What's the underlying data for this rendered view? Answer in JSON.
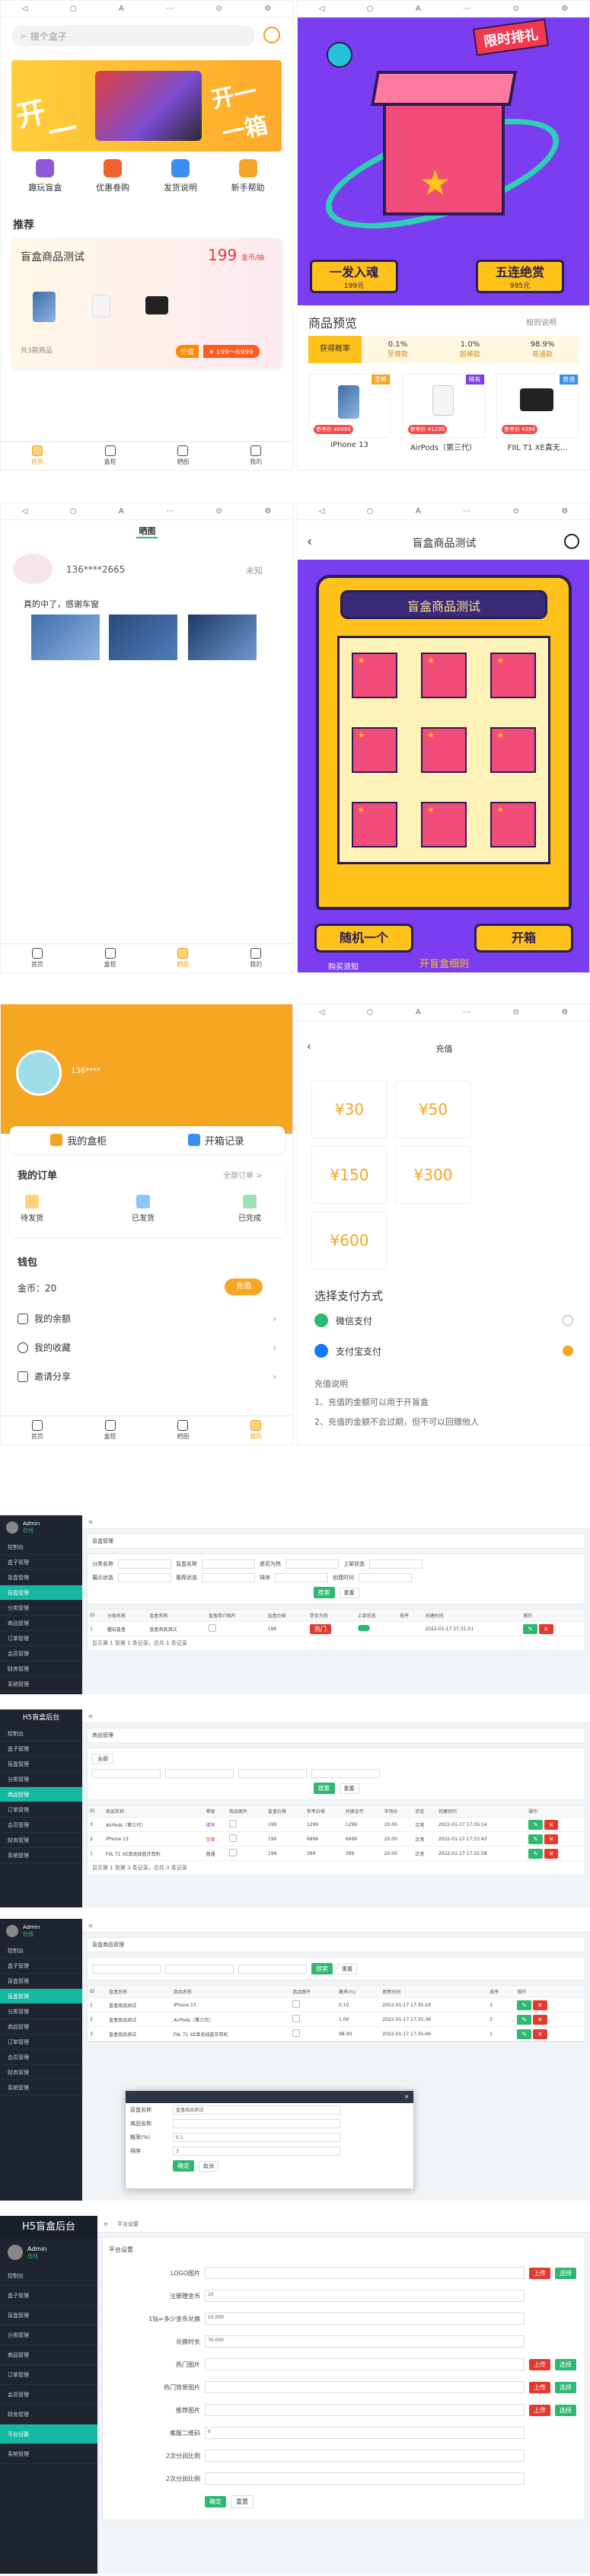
{
  "home": {
    "search_placeholder": "搜个盒子",
    "banner_words": [
      "开",
      "一",
      "开一",
      "一箱"
    ],
    "menu": [
      "趣玩盲盒",
      "优惠卷购",
      "发货说明",
      "新手帮助"
    ],
    "section_title": "推荐",
    "card_title": "盲盒商品测试",
    "card_price": "199",
    "card_price_unit": "金币/抽",
    "card_count": "共3款商品",
    "card_tag": "价值",
    "card_range": "¥ 199～6999",
    "tabs": [
      "首页",
      "盒柜",
      "晒图",
      "我的"
    ]
  },
  "box_detail": {
    "badge": "限时排礼",
    "btn1_label": "一发入魂",
    "btn1_price": "199元",
    "btn2_label": "五连绝赏",
    "btn2_price": "995元",
    "preview_title": "商品预览",
    "rule_link": "规则说明",
    "prob_header": "获得概率",
    "probs": [
      {
        "value": "0.1%",
        "label": "至尊款"
      },
      {
        "value": "1.0%",
        "label": "超稀款"
      },
      {
        "value": "98.9%",
        "label": "普通款"
      }
    ],
    "items": [
      {
        "tag": "至尊",
        "price": "参考价 ¥6999",
        "name": "iPhone 13"
      },
      {
        "tag": "稀有",
        "price": "参考价 ¥1299",
        "name": "AirPods（第三代）"
      },
      {
        "tag": "普通",
        "price": "参考价 ¥399",
        "name": "FIIL T1 XE真无..."
      }
    ]
  },
  "show": {
    "title": "晒图",
    "user": "136****2665",
    "status": "未知",
    "text": "真的中了，感谢车窗",
    "tabs": [
      "首页",
      "盒柜",
      "晒图",
      "我的"
    ]
  },
  "machine": {
    "title": "盲盒商品测试",
    "screen": "盲盒商品测试",
    "btn_random": "随机一个",
    "btn_open": "开箱",
    "rule": "开盲盒细则",
    "notice": "购买须知"
  },
  "mine": {
    "user": "136****",
    "card1": "我的盒柜",
    "card2": "开箱记录",
    "orders_title": "我的订单",
    "orders_all": "全部订单 >",
    "order_states": [
      "待发货",
      "已发货",
      "已完成"
    ],
    "wallet_title": "钱包",
    "coins_label": "金币：20",
    "recharge": "充值",
    "links": [
      "我的余额",
      "我的收藏",
      "邀请分享"
    ],
    "tabs": [
      "首页",
      "盒柜",
      "晒图",
      "我的"
    ]
  },
  "recharge": {
    "title": "充值",
    "amounts": [
      "¥30",
      "¥50",
      "¥150",
      "¥300",
      "¥600"
    ],
    "pay_title": "选择支付方式",
    "pay_wechat": "微信支付",
    "pay_alipay": "支付宝支付",
    "note_title": "充值说明",
    "notes": [
      "1、充值的金额可以用于开盲盒",
      "2、充值的金额不会过期，但不可以回赠他人"
    ]
  },
  "admin1": {
    "brand": "Admin",
    "user_status": "在线",
    "menu": [
      "控制台",
      "盒子管理",
      "盲盒管理",
      "盲盒管理",
      "分类管理",
      "商品管理",
      "订单管理",
      "会员管理",
      "财务管理",
      "系统管理"
    ],
    "crumb": "盲盒管理",
    "filters": [
      "分类名称",
      "盲盒名称",
      "是否为热",
      "上架状态",
      "展示状态",
      "推荐状态",
      "排序",
      "创建时间"
    ],
    "search": "搜索",
    "reset": "重置",
    "columns": [
      "ID",
      "分类名称",
      "盲盒名称",
      "盲盒简介图片",
      "盲盒价格",
      "是否为热",
      "上架状态",
      "排序",
      "创建时间",
      "操作"
    ],
    "row": [
      "1",
      "趣玩盲盒",
      "盲盒商品测试",
      "",
      "199",
      "热门",
      "上架",
      "",
      "2022-01-17 17:31:51"
    ],
    "footer": "显示第 1 到第 1 条记录，总共 1 条记录"
  },
  "admin2": {
    "brand": "H5盲盒后台",
    "crumb": "商品管理",
    "tab_all": "全部",
    "columns": [
      "ID",
      "商品名称",
      "等级",
      "商品图片",
      "盲盒价格",
      "盒价",
      "参考价格",
      "兑换金币",
      "市场价",
      "库存",
      "状态",
      "创建时间",
      "更新时间",
      "操作"
    ],
    "rows": [
      [
        "3",
        "AirPods（第三代）",
        "稀有",
        "",
        "199",
        "1299",
        "1299",
        "20.00",
        "正常",
        "2022-01-17 17:35:14"
      ],
      [
        "2",
        "iPhone 13",
        "至尊",
        "",
        "199",
        "6999",
        "6999",
        "20.00",
        "正常",
        "2022-01-17 17:33:43"
      ],
      [
        "1",
        "FIIL T1 XE真无线蓝牙耳机",
        "普通",
        "",
        "199",
        "399",
        "399",
        "20.00",
        "正常",
        "2022-01-17 17:32:58"
      ]
    ],
    "footer": "显示第 1 到第 3 条记录，总共 3 条记录"
  },
  "admin3": {
    "crumb": "盲盒商品管理",
    "columns": [
      "ID",
      "盲盒名称",
      "商品名称",
      "商品图片",
      "概率(%)",
      "更新时间",
      "排序",
      "操作"
    ],
    "rows": [
      [
        "1",
        "盲盒商品测试",
        "iPhone 13",
        "",
        "0.10",
        "2022-01-17 17:35:29",
        "3"
      ],
      [
        "2",
        "盲盒商品测试",
        "AirPods（第三代）",
        "",
        "1.00",
        "2022-01-17 17:35:36",
        "2"
      ],
      [
        "3",
        "盲盒商品测试",
        "FIIL T1 XE真无线蓝牙耳机",
        "",
        "98.90",
        "2022-01-17 17:35:46",
        "1"
      ]
    ],
    "modal_fields": [
      "盲盒名称",
      "商品名称",
      "概率(%)",
      "排序"
    ],
    "modal_values": [
      "盲盒商品测试",
      "",
      "0.1",
      "3"
    ],
    "confirm": "确定",
    "cancel": "取消"
  },
  "admin4": {
    "brand": "H5盲盒后台",
    "crumb": "平台设置",
    "fields": [
      "LOGO图片",
      "注册赠金币",
      "1钻=多少金币兑换",
      "兑换时长",
      "热门图片",
      "热门背景图片",
      "推荐图片",
      "客服二维码",
      "2次分润比例",
      "2次分润比例"
    ],
    "values": [
      "",
      "10",
      "10.000",
      "70.000",
      "",
      "",
      "",
      "0",
      "",
      ""
    ],
    "upload": "上传",
    "choose": "选择",
    "confirm": "确定",
    "reset": "重置"
  }
}
